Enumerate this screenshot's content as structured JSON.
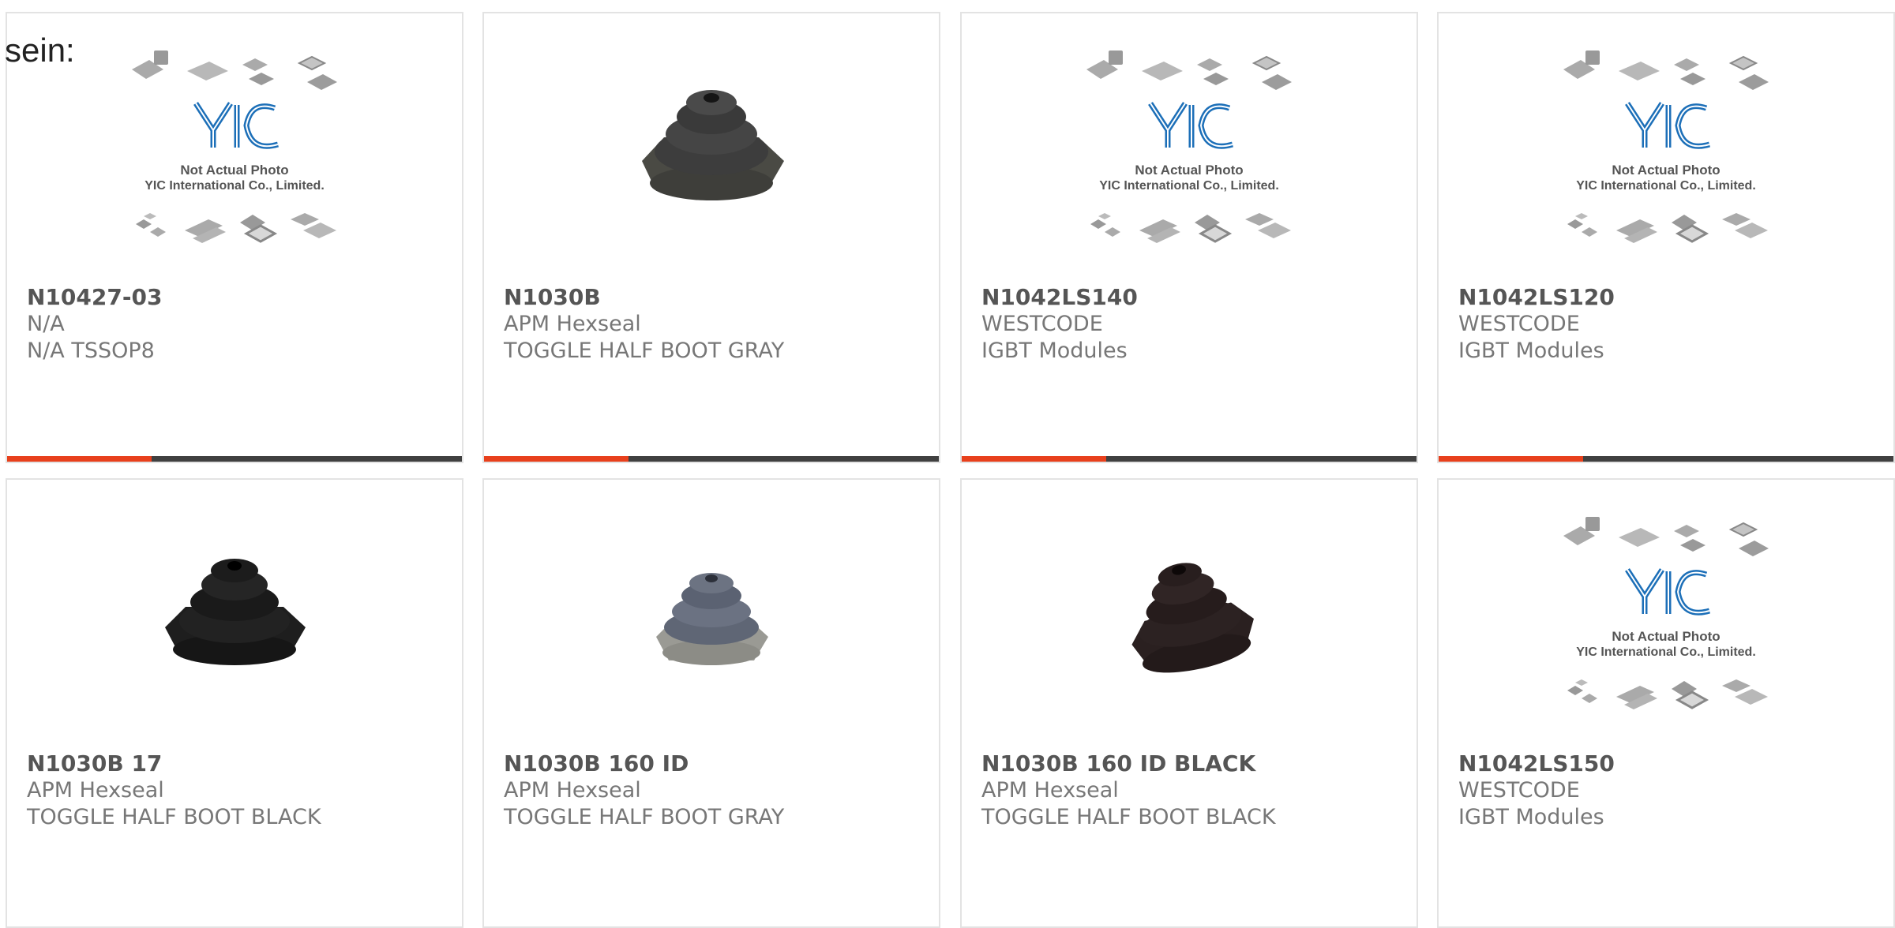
{
  "page": {
    "intro_text": "sein:"
  },
  "placeholder": {
    "logo": "YIC",
    "line1": "Not Actual Photo",
    "line2": "YIC International Co., Limited."
  },
  "colors": {
    "accent": "#e8401c",
    "bar": "#404040",
    "border": "#e3e3e3"
  },
  "products": [
    {
      "part": "N10427-03",
      "manufacturer": "N/A",
      "description": "N/A TSSOP8",
      "image": "yic-placeholder-icon"
    },
    {
      "part": "N1030B",
      "manufacturer": "APM Hexseal",
      "description": "TOGGLE HALF BOOT GRAY",
      "image": "rubber-boot-dark-gray-icon"
    },
    {
      "part": "N1042LS140",
      "manufacturer": "WESTCODE",
      "description": "IGBT Modules",
      "image": "yic-placeholder-icon"
    },
    {
      "part": "N1042LS120",
      "manufacturer": "WESTCODE",
      "description": "IGBT Modules",
      "image": "yic-placeholder-icon"
    },
    {
      "part": "N1030B 17",
      "manufacturer": "APM Hexseal",
      "description": "TOGGLE HALF BOOT BLACK",
      "image": "rubber-boot-black-icon"
    },
    {
      "part": "N1030B 160 ID",
      "manufacturer": "APM Hexseal",
      "description": "TOGGLE HALF BOOT GRAY",
      "image": "rubber-boot-gray-icon"
    },
    {
      "part": "N1030B 160 ID BLACK",
      "manufacturer": "APM Hexseal",
      "description": "TOGGLE HALF BOOT BLACK",
      "image": "rubber-boot-black-brown-icon"
    },
    {
      "part": "N1042LS150",
      "manufacturer": "WESTCODE",
      "description": "IGBT Modules",
      "image": "yic-placeholder-icon"
    }
  ]
}
